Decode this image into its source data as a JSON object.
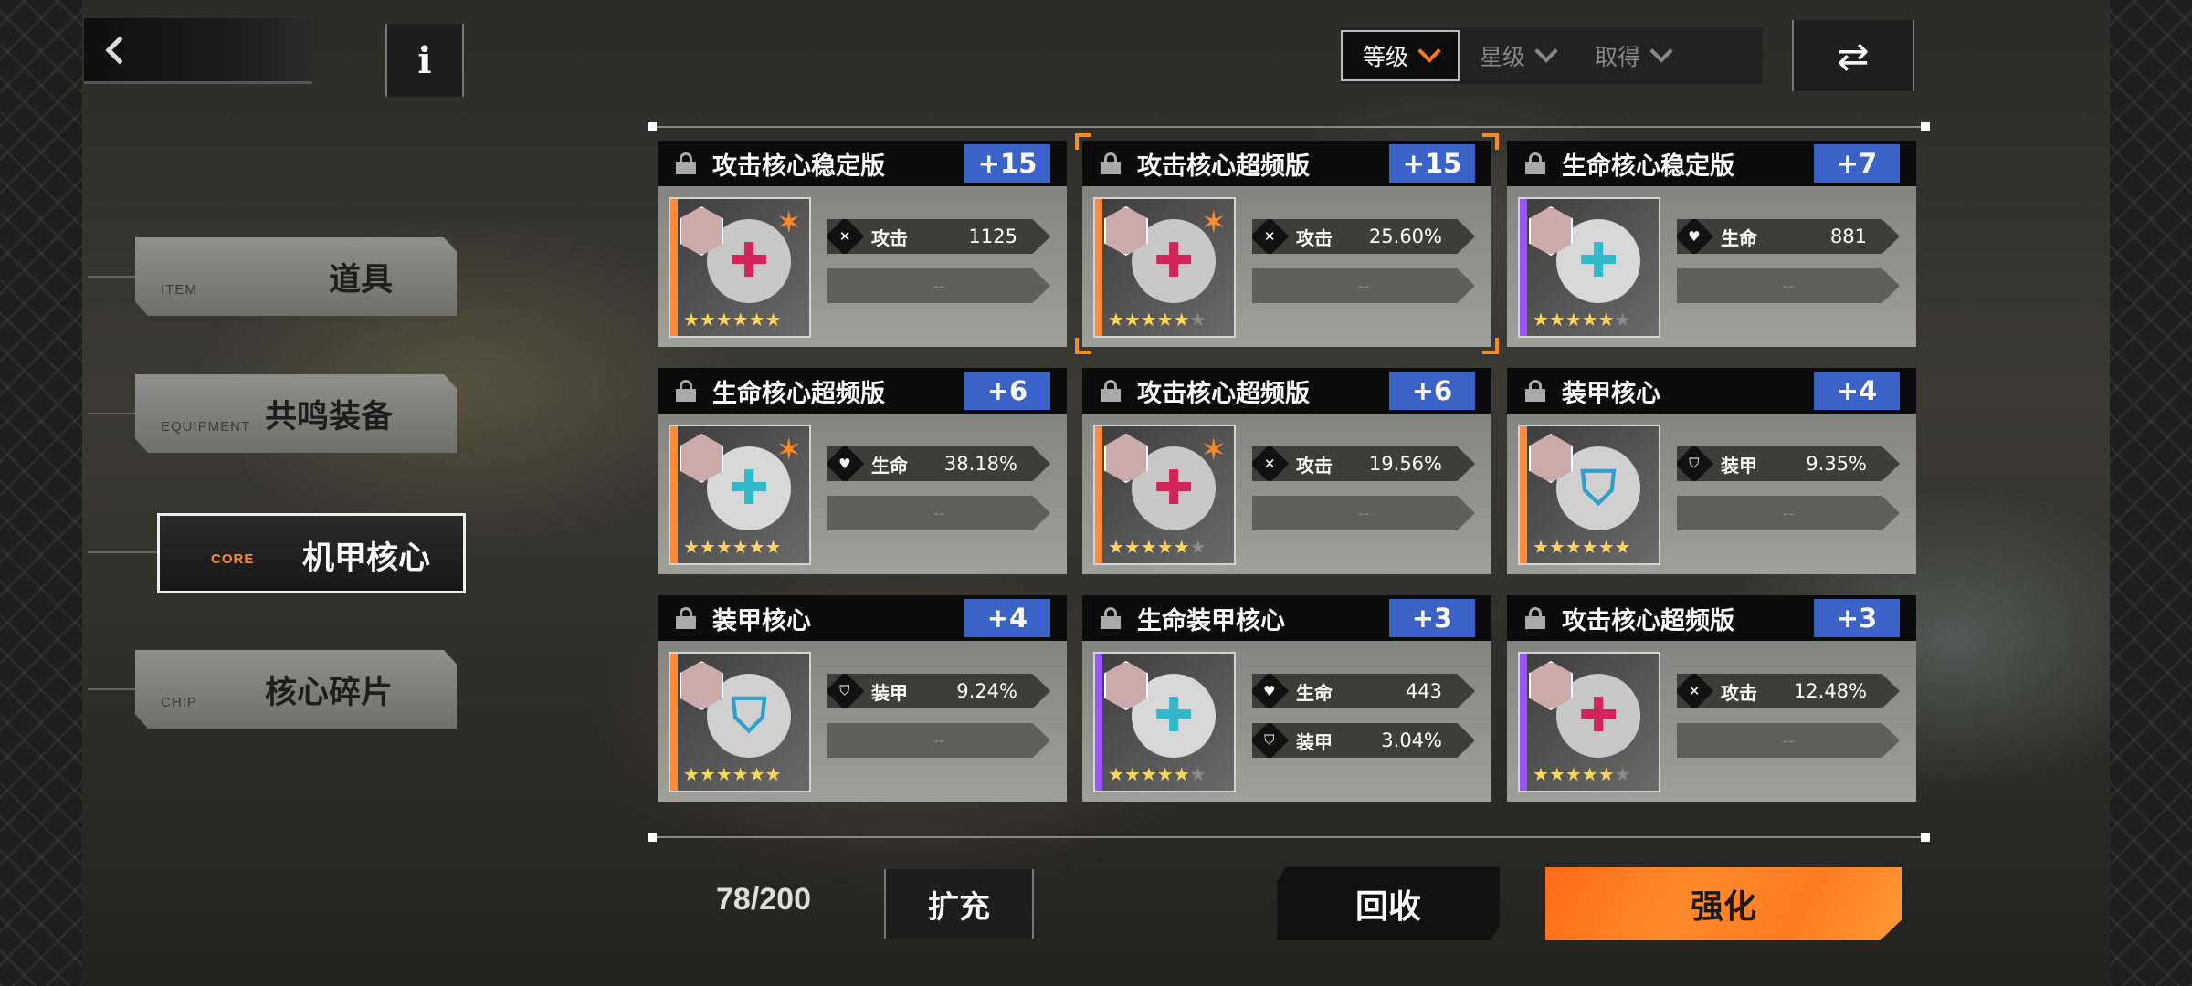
{
  "nav": {
    "back_icon": "chevron-left-icon",
    "info_label": "i"
  },
  "categories": [
    {
      "en": "ITEM",
      "cn": "道具",
      "active": false
    },
    {
      "en": "EQUIPMENT",
      "cn": "共鸣装备",
      "active": false
    },
    {
      "en": "CORE",
      "cn": "机甲核心",
      "active": true
    },
    {
      "en": "CHIP",
      "cn": "核心碎片",
      "active": false
    }
  ],
  "sort": {
    "options": [
      {
        "label": "等级",
        "active": true
      },
      {
        "label": "星级",
        "active": false
      },
      {
        "label": "取得",
        "active": false
      }
    ],
    "swap_icon": "⇄"
  },
  "cores": [
    {
      "name": "攻击核心稳定版",
      "level": "+15",
      "rarity": "#ff8a3a",
      "emblem": "attack",
      "stars": 6,
      "max_stars": 6,
      "stats": [
        {
          "icon": "✕",
          "name": "攻击",
          "value": "1125"
        },
        {
          "empty": "--"
        }
      ],
      "selected": false
    },
    {
      "name": "攻击核心超频版",
      "level": "+15",
      "rarity": "#ff8a3a",
      "emblem": "attack",
      "stars": 5,
      "max_stars": 6,
      "stats": [
        {
          "icon": "✕",
          "name": "攻击",
          "value": "25.60%"
        },
        {
          "empty": "--"
        }
      ],
      "selected": true
    },
    {
      "name": "生命核心稳定版",
      "level": "+7",
      "rarity": "#9a55ff",
      "emblem": "life",
      "stars": 5,
      "max_stars": 6,
      "stats": [
        {
          "icon": "♥",
          "name": "生命",
          "value": "881"
        },
        {
          "empty": "--"
        }
      ],
      "selected": false
    },
    {
      "name": "生命核心超频版",
      "level": "+6",
      "rarity": "#ff8a3a",
      "emblem": "life",
      "stars": 6,
      "max_stars": 6,
      "stats": [
        {
          "icon": "♥",
          "name": "生命",
          "value": "38.18%"
        },
        {
          "empty": "--"
        }
      ],
      "selected": false
    },
    {
      "name": "攻击核心超频版",
      "level": "+6",
      "rarity": "#ff8a3a",
      "emblem": "attack",
      "stars": 5,
      "max_stars": 6,
      "stats": [
        {
          "icon": "✕",
          "name": "攻击",
          "value": "19.56%"
        },
        {
          "empty": "--"
        }
      ],
      "selected": false
    },
    {
      "name": "装甲核心",
      "level": "+4",
      "rarity": "#ff8a3a",
      "emblem": "armor",
      "stars": 6,
      "max_stars": 6,
      "stats": [
        {
          "icon": "⛉",
          "name": "装甲",
          "value": "9.35%"
        },
        {
          "empty": "--"
        }
      ],
      "selected": false
    },
    {
      "name": "装甲核心",
      "level": "+4",
      "rarity": "#ff8a3a",
      "emblem": "armor",
      "stars": 6,
      "max_stars": 6,
      "stats": [
        {
          "icon": "⛉",
          "name": "装甲",
          "value": "9.24%"
        },
        {
          "empty": "--"
        }
      ],
      "selected": false
    },
    {
      "name": "生命装甲核心",
      "level": "+3",
      "rarity": "#9a55ff",
      "emblem": "life-armor",
      "stars": 5,
      "max_stars": 6,
      "stats": [
        {
          "icon": "♥",
          "name": "生命",
          "value": "443"
        },
        {
          "icon": "⛉",
          "name": "装甲",
          "value": "3.04%"
        }
      ],
      "selected": false
    },
    {
      "name": "攻击核心超频版",
      "level": "+3",
      "rarity": "#9a55ff",
      "emblem": "attack",
      "stars": 5,
      "max_stars": 6,
      "stats": [
        {
          "icon": "✕",
          "name": "攻击",
          "value": "12.48%"
        },
        {
          "empty": "--"
        }
      ],
      "selected": false
    }
  ],
  "footer": {
    "count": "78/200",
    "expand_label": "扩充",
    "recycle_label": "回收",
    "enhance_label": "强化"
  },
  "colors": {
    "level_badge": "#3b63c7",
    "accent": "#ff8a1a"
  }
}
